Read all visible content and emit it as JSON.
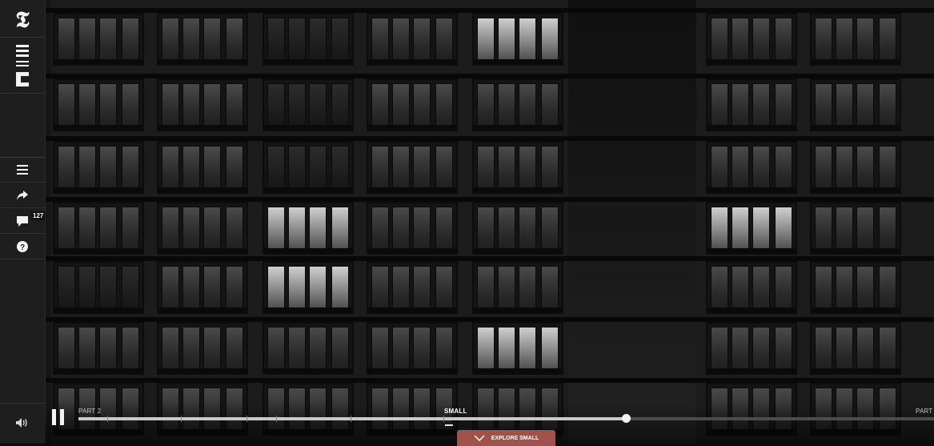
{
  "sidebar": {
    "logo_nyt": "𝕿",
    "logo_nfb": "NFB ONF",
    "icons": [
      "menu-icon",
      "share-icon",
      "comment-icon",
      "help-icon",
      "volume-icon"
    ],
    "comment_count": "127"
  },
  "player": {
    "state": "playing",
    "part_label_left": "PART 2",
    "part_label_right": "PART",
    "segment_label": "SMALL",
    "progress": 0.64,
    "explore_label": "EXPLORE SMALL"
  },
  "colors": {
    "explore_button": "#a3524a",
    "sidebar": "#1e1e1e"
  }
}
